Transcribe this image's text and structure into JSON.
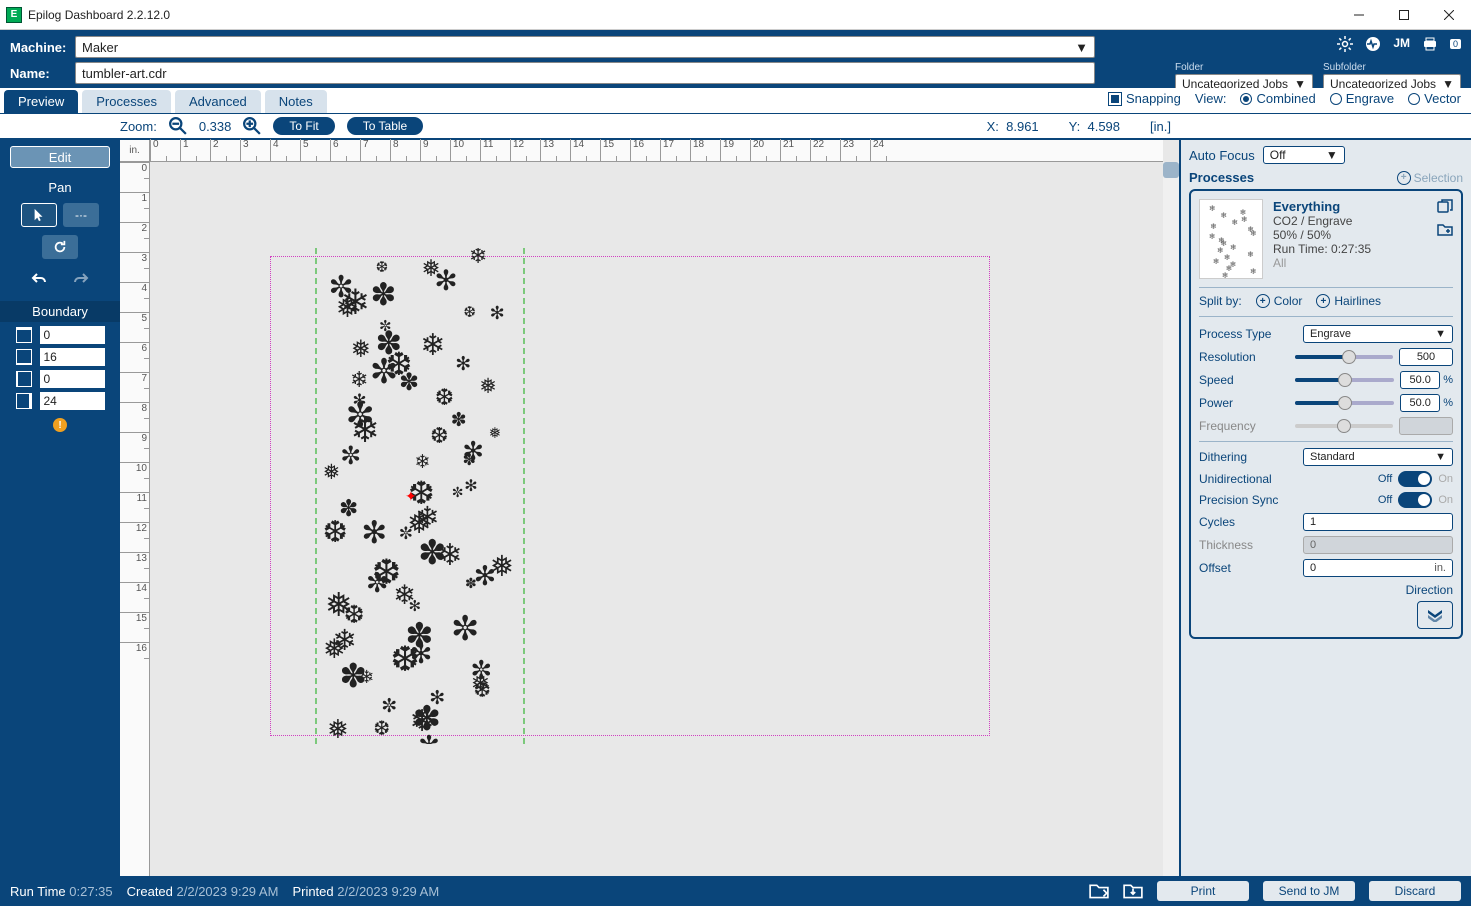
{
  "app": {
    "title": "Epilog Dashboard 2.2.12.0"
  },
  "topbar": {
    "machine_label": "Machine:",
    "machine_value": "Maker",
    "name_label": "Name:",
    "name_value": "tumbler-art.cdr",
    "queue_badge": "0",
    "folder_label": "Folder",
    "folder_value": "Uncategorized Jobs",
    "subfolder_label": "Subfolder",
    "subfolder_value": "Uncategorized Jobs"
  },
  "tabs": {
    "preview": "Preview",
    "processes": "Processes",
    "advanced": "Advanced",
    "notes": "Notes"
  },
  "snapping": {
    "label": "Snapping"
  },
  "view": {
    "label": "View:",
    "combined": "Combined",
    "engrave": "Engrave",
    "vector": "Vector"
  },
  "zoom": {
    "label": "Zoom:",
    "value": "0.338",
    "to_fit": "To Fit",
    "to_table": "To Table",
    "x_label": "X:",
    "x_value": "8.961",
    "y_label": "Y:",
    "y_value": "4.598",
    "unit": "[in.]"
  },
  "sidebar": {
    "edit": "Edit",
    "pan": "Pan",
    "boundary": "Boundary",
    "b_top": "0",
    "b_bottom": "16",
    "b_left": "0",
    "b_right": "24"
  },
  "ruler": {
    "unit": "in."
  },
  "right": {
    "autofocus_label": "Auto Focus",
    "autofocus_value": "Off",
    "processes_label": "Processes",
    "selection_label": "Selection",
    "proc": {
      "title": "Everything",
      "line1": "CO2 / Engrave",
      "line2": "50% / 50%",
      "line3": "Run Time: 0:27:35",
      "line4": "All"
    },
    "split_label": "Split by:",
    "color": "Color",
    "hairlines": "Hairlines",
    "process_type_label": "Process Type",
    "process_type_value": "Engrave",
    "resolution_label": "Resolution",
    "resolution_value": "500",
    "speed_label": "Speed",
    "speed_value": "50.0",
    "speed_unit": "%",
    "power_label": "Power",
    "power_value": "50.0",
    "power_unit": "%",
    "frequency_label": "Frequency",
    "dithering_label": "Dithering",
    "dithering_value": "Standard",
    "unidirectional_label": "Unidirectional",
    "off": "Off",
    "on": "On",
    "precision_label": "Precision Sync",
    "cycles_label": "Cycles",
    "cycles_value": "1",
    "thickness_label": "Thickness",
    "thickness_value": "0",
    "offset_label": "Offset",
    "offset_value": "0",
    "offset_unit": "in.",
    "direction_label": "Direction"
  },
  "bottom": {
    "runtime_label": "Run Time",
    "runtime_value": "0:27:35",
    "created_label": "Created",
    "created_value": "2/2/2023 9:29 AM",
    "printed_label": "Printed",
    "printed_value": "2/2/2023 9:29 AM",
    "print": "Print",
    "send_jm": "Send to JM",
    "discard": "Discard"
  }
}
